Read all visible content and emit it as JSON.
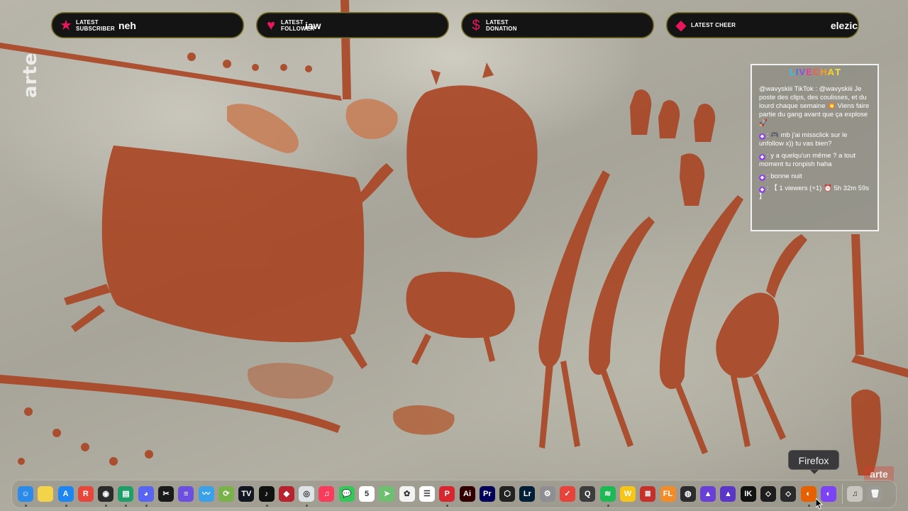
{
  "alerts": [
    {
      "icon": "star-icon",
      "icon_glyph": "★",
      "label": "LATEST SUBSCRIBER",
      "value": "neh"
    },
    {
      "icon": "heart-icon",
      "icon_glyph": "♥",
      "label": "LATEST FOLLOWER",
      "value": "iaw"
    },
    {
      "icon": "dollar-icon",
      "icon_glyph": "$",
      "label": "LATEST DONATION",
      "value": ""
    },
    {
      "icon": "diamond-icon",
      "icon_glyph": "◆",
      "label": "LATEST CHEER",
      "value": "elezic"
    }
  ],
  "watermark": {
    "text": "arte",
    "badge": "arte"
  },
  "chat": {
    "title": "LIVECHAT",
    "title_colors": [
      "#2ec4f1",
      "#4a6ee0",
      "#8a4fe0",
      "#e0409a",
      "#ff5a3c",
      "#ff9a1f",
      "#ffd11f",
      "#f6e23a"
    ],
    "messages": [
      {
        "user": "",
        "text": "@wavyskiii      TikTok : @wavyskiii Je poste des clips, des coulisses, et du lourd chaque semaine 💥 Viens faire partie du gang avant que ça explose 🚀"
      },
      {
        "user": "",
        "text": ": 🎮 mb j'ai missclick sur le unfollow x)) tu vas bien?"
      },
      {
        "user": "",
        "text": ": y a quelqu'un même ? a tout moment tu ronpish haha"
      },
      {
        "user": "",
        "text": ": bonne nuit"
      },
      {
        "user": "",
        "text": ": 【 1 viewers (+1) ⏰ 5h 32m 59s 】"
      }
    ]
  },
  "tooltip": {
    "text": "Firefox"
  },
  "dock": {
    "apps": [
      {
        "name": "finder-icon",
        "color": "#2a8bea",
        "glyph": "☺",
        "running": true
      },
      {
        "name": "notes-icon",
        "color": "#f3d34a",
        "glyph": "",
        "running": false
      },
      {
        "name": "app-store-icon",
        "color": "#1d86f2",
        "glyph": "A",
        "running": true
      },
      {
        "name": "creative-cloud-icon",
        "color": "#e8463b",
        "glyph": "R",
        "running": false
      },
      {
        "name": "obs-icon",
        "color": "#2b2b2b",
        "glyph": "◉",
        "running": true
      },
      {
        "name": "terminal-icon",
        "color": "#1f9e6a",
        "glyph": "▤",
        "running": true
      },
      {
        "name": "discord-icon",
        "color": "#5865f2",
        "glyph": "◕",
        "running": true
      },
      {
        "name": "capcut-icon",
        "color": "#1a1a1a",
        "glyph": "✂",
        "running": false
      },
      {
        "name": "streamlabs-icon",
        "color": "#6b4fe0",
        "glyph": "≡",
        "running": false
      },
      {
        "name": "freeform-icon",
        "color": "#3aa0e8",
        "glyph": "〰",
        "running": false
      },
      {
        "name": "photos-sync-icon",
        "color": "#7ab24a",
        "glyph": "⟳",
        "running": false
      },
      {
        "name": "tradingview-icon",
        "color": "#131722",
        "glyph": "TV",
        "running": false
      },
      {
        "name": "tiktok-icon",
        "color": "#111111",
        "glyph": "♪",
        "running": true
      },
      {
        "name": "red-app-icon",
        "color": "#b8232f",
        "glyph": "◆",
        "running": false
      },
      {
        "name": "chrome-icon",
        "color": "#dfe3e6",
        "glyph": "◎",
        "running": true
      },
      {
        "name": "music-icon",
        "color": "#fa3c5c",
        "glyph": "♫",
        "running": false
      },
      {
        "name": "messages-icon",
        "color": "#35c759",
        "glyph": "💬",
        "running": false
      },
      {
        "name": "calendar-icon",
        "color": "#ffffff",
        "glyph": "5",
        "running": false
      },
      {
        "name": "maps-icon",
        "color": "#6cc070",
        "glyph": "➤",
        "running": false
      },
      {
        "name": "photos-icon",
        "color": "#f2f2f2",
        "glyph": "✿",
        "running": false
      },
      {
        "name": "reminders-icon",
        "color": "#ffffff",
        "glyph": "☰",
        "running": false
      },
      {
        "name": "pdf-app-icon",
        "color": "#d7262e",
        "glyph": "P",
        "running": true
      },
      {
        "name": "illustrator-icon",
        "color": "#330000",
        "glyph": "Ai",
        "running": false
      },
      {
        "name": "premiere-icon",
        "color": "#00005b",
        "glyph": "Pr",
        "running": false
      },
      {
        "name": "unity-icon",
        "color": "#222222",
        "glyph": "⬡",
        "running": false
      },
      {
        "name": "lightroom-icon",
        "color": "#001e36",
        "glyph": "Lr",
        "running": false
      },
      {
        "name": "settings-icon",
        "color": "#8e8e93",
        "glyph": "⚙",
        "running": false
      },
      {
        "name": "todo-icon",
        "color": "#e8433b",
        "glyph": "✓",
        "running": false
      },
      {
        "name": "quicktime-icon",
        "color": "#3c3c3c",
        "glyph": "Q",
        "running": false
      },
      {
        "name": "spotify-icon",
        "color": "#1db954",
        "glyph": "≋",
        "running": true
      },
      {
        "name": "waves-icon",
        "color": "#f5c518",
        "glyph": "W",
        "running": false
      },
      {
        "name": "stacks-icon",
        "color": "#c6302b",
        "glyph": "≣",
        "running": false
      },
      {
        "name": "fl-studio-icon",
        "color": "#f28c28",
        "glyph": "FL",
        "running": false
      },
      {
        "name": "plugin-icon",
        "color": "#2c2c2e",
        "glyph": "◍",
        "running": false
      },
      {
        "name": "arturia-icon",
        "color": "#6a3fd8",
        "glyph": "▲",
        "running": false
      },
      {
        "name": "analog-lab-icon",
        "color": "#5b34c8",
        "glyph": "▲",
        "running": false
      },
      {
        "name": "ik-multimedia-icon",
        "color": "#111111",
        "glyph": "IK",
        "running": false
      },
      {
        "name": "nav-app-icon",
        "color": "#1d1d1f",
        "glyph": "⬦",
        "running": false
      },
      {
        "name": "robot-app-icon",
        "color": "#2a2a2a",
        "glyph": "⬦",
        "running": false
      },
      {
        "name": "firefox-icon",
        "color": "#e66000",
        "glyph": "◐",
        "running": true
      },
      {
        "name": "firefox-dev-icon",
        "color": "#7b42f6",
        "glyph": "◐",
        "running": false
      }
    ],
    "trailing": [
      {
        "name": "music-folder-icon",
        "color": "#c9c6c0",
        "glyph": "♫"
      },
      {
        "name": "trash-icon",
        "color": "#9c9a95",
        "glyph": "🗑"
      }
    ]
  }
}
